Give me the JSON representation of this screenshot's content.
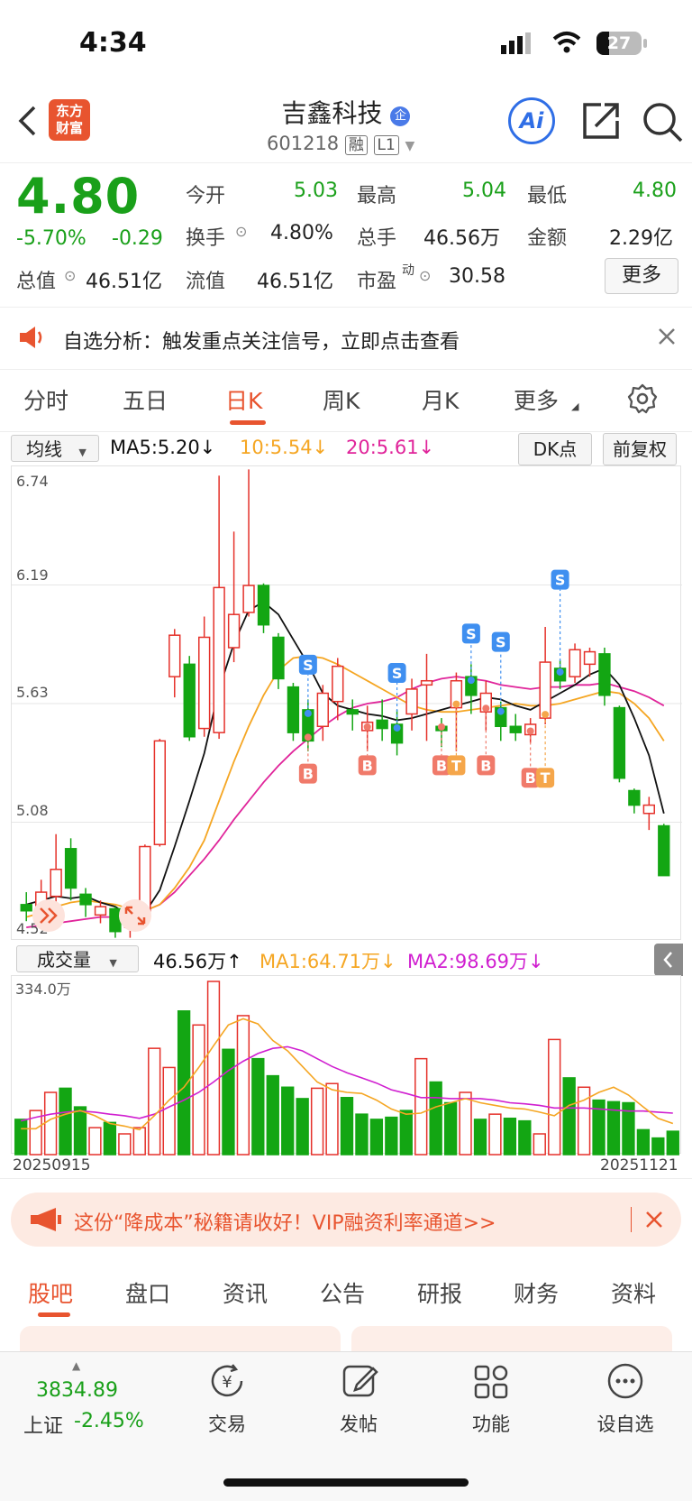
{
  "status_bar": {
    "time": "4:34",
    "battery": "27"
  },
  "header": {
    "brand_line1": "东方",
    "brand_line2": "财富",
    "title": "吉鑫科技",
    "badge": "企",
    "code": "601218",
    "tag1": "融",
    "tag2": "L1",
    "ai_label": "Ai"
  },
  "quote": {
    "price": "4.80",
    "change_pct": "-5.70%",
    "change": "-0.29",
    "open_label": "今开",
    "open": "5.03",
    "high_label": "最高",
    "high": "5.04",
    "low_label": "最低",
    "low": "4.80",
    "turnover_label": "换手",
    "turnover": "4.80%",
    "volume_label": "总手",
    "volume": "46.56万",
    "amount_label": "金额",
    "amount": "2.29亿",
    "mktcap_label": "总值",
    "mktcap": "46.51亿",
    "float_label": "流值",
    "float": "46.51亿",
    "pe_label": "市盈",
    "pe_sup": "动",
    "pe": "30.58",
    "more_button": "更多"
  },
  "notice": {
    "text": "自选分析：触发重点关注信号，立即点击查看"
  },
  "chart_tabs": [
    "分时",
    "五日",
    "日K",
    "周K",
    "月K",
    "更多"
  ],
  "active_tab": "日K",
  "ma_bar": {
    "selector": "均线",
    "ma5": "MA5:5.20↓",
    "ma10": "10:5.54↓",
    "ma20": "20:5.61↓",
    "dk": "DK点",
    "adjust": "前复权"
  },
  "price_axis": [
    "6.74",
    "6.19",
    "5.63",
    "5.08",
    "4.52"
  ],
  "volume_bar": {
    "selector": "成交量",
    "vol": "46.56万↑",
    "ma1": "MA1:64.71万↓",
    "ma2": "MA2:98.69万↓",
    "axis_max": "334.0万",
    "start_date": "20250915",
    "end_date": "20251121"
  },
  "colors": {
    "up": "#e5312a",
    "down": "#13a613",
    "ma5": "#111111",
    "ma10": "#f5a623",
    "ma20": "#e0249a",
    "accent": "#e8542f"
  },
  "promo": {
    "text": "这份“降成本”秘籍请收好！VIP融资利率通道>>"
  },
  "bottom_tabs": [
    "股吧",
    "盘口",
    "资讯",
    "公告",
    "研报",
    "财务",
    "资料"
  ],
  "active_bottom_tab": "股吧",
  "dock": {
    "index_value": "3834.89",
    "index_name": "上证",
    "index_change": "-2.45%",
    "items": [
      "交易",
      "发帖",
      "功能",
      "设自选"
    ]
  },
  "chart_data": {
    "type": "candlestick",
    "y_range": [
      4.52,
      6.74
    ],
    "x_range": [
      "20250915",
      "20251121"
    ],
    "candles": [
      {
        "o": 4.66,
        "c": 4.63,
        "h": 4.72,
        "l": 4.58
      },
      {
        "o": 4.63,
        "c": 4.72,
        "h": 4.78,
        "l": 4.58
      },
      {
        "o": 4.7,
        "c": 4.83,
        "h": 5.0,
        "l": 4.65
      },
      {
        "o": 4.93,
        "c": 4.74,
        "h": 4.98,
        "l": 4.68
      },
      {
        "o": 4.71,
        "c": 4.66,
        "h": 4.74,
        "l": 4.6
      },
      {
        "o": 4.61,
        "c": 4.65,
        "h": 4.68,
        "l": 4.57
      },
      {
        "o": 4.64,
        "c": 4.53,
        "h": 4.65,
        "l": 4.5
      },
      {
        "o": 4.55,
        "c": 4.6,
        "h": 4.62,
        "l": 4.5
      },
      {
        "o": 4.62,
        "c": 4.94,
        "h": 4.95,
        "l": 4.6
      },
      {
        "o": 4.95,
        "c": 5.45,
        "h": 5.46,
        "l": 4.94
      },
      {
        "o": 5.76,
        "c": 5.96,
        "h": 5.99,
        "l": 5.66
      },
      {
        "o": 5.82,
        "c": 5.47,
        "h": 5.86,
        "l": 5.45
      },
      {
        "o": 5.51,
        "c": 5.95,
        "h": 6.05,
        "l": 5.47
      },
      {
        "o": 5.49,
        "c": 6.19,
        "h": 6.73,
        "l": 5.46
      },
      {
        "o": 5.9,
        "c": 6.06,
        "h": 6.46,
        "l": 5.83
      },
      {
        "o": 6.07,
        "c": 6.2,
        "h": 6.76,
        "l": 6.05
      },
      {
        "o": 6.2,
        "c": 6.01,
        "h": 6.21,
        "l": 5.97
      },
      {
        "o": 5.95,
        "c": 5.75,
        "h": 5.97,
        "l": 5.7
      },
      {
        "o": 5.71,
        "c": 5.49,
        "h": 5.73,
        "l": 5.45
      },
      {
        "o": 5.6,
        "c": 5.45,
        "h": 5.65,
        "l": 5.4
      },
      {
        "o": 5.52,
        "c": 5.68,
        "h": 5.72,
        "l": 5.45
      },
      {
        "o": 5.64,
        "c": 5.81,
        "h": 5.85,
        "l": 5.55
      },
      {
        "o": 5.6,
        "c": 5.58,
        "h": 5.65,
        "l": 5.5
      },
      {
        "o": 5.5,
        "c": 5.54,
        "h": 5.62,
        "l": 5.4
      },
      {
        "o": 5.55,
        "c": 5.51,
        "h": 5.65,
        "l": 5.45
      },
      {
        "o": 5.53,
        "c": 5.44,
        "h": 5.6,
        "l": 5.38
      },
      {
        "o": 5.58,
        "c": 5.7,
        "h": 5.75,
        "l": 5.5
      },
      {
        "o": 5.72,
        "c": 5.74,
        "h": 5.87,
        "l": 5.45
      },
      {
        "o": 5.52,
        "c": 5.5,
        "h": 5.56,
        "l": 5.42
      },
      {
        "o": 5.61,
        "c": 5.74,
        "h": 5.78,
        "l": 5.4
      },
      {
        "o": 5.76,
        "c": 5.67,
        "h": 5.82,
        "l": 5.58
      },
      {
        "o": 5.59,
        "c": 5.68,
        "h": 5.74,
        "l": 5.5
      },
      {
        "o": 5.61,
        "c": 5.52,
        "h": 5.64,
        "l": 5.45
      },
      {
        "o": 5.52,
        "c": 5.49,
        "h": 5.58,
        "l": 5.45
      },
      {
        "o": 5.48,
        "c": 5.53,
        "h": 5.56,
        "l": 5.44
      },
      {
        "o": 5.56,
        "c": 5.83,
        "h": 6.0,
        "l": 5.53
      },
      {
        "o": 5.8,
        "c": 5.74,
        "h": 5.84,
        "l": 5.7
      },
      {
        "o": 5.76,
        "c": 5.89,
        "h": 5.92,
        "l": 5.73
      },
      {
        "o": 5.82,
        "c": 5.88,
        "h": 5.9,
        "l": 5.76
      },
      {
        "o": 5.87,
        "c": 5.67,
        "h": 5.9,
        "l": 5.62
      },
      {
        "o": 5.61,
        "c": 5.27,
        "h": 5.62,
        "l": 5.25
      },
      {
        "o": 5.21,
        "c": 5.14,
        "h": 5.22,
        "l": 5.1
      },
      {
        "o": 5.1,
        "c": 5.14,
        "h": 5.18,
        "l": 5.02
      },
      {
        "o": 5.04,
        "c": 4.8,
        "h": 5.05,
        "l": 4.8
      }
    ],
    "ma5": [
      4.66,
      4.68,
      4.7,
      4.69,
      4.7,
      4.67,
      4.65,
      4.6,
      4.62,
      4.73,
      4.94,
      5.16,
      5.39,
      5.7,
      5.92,
      6.08,
      6.12,
      6.06,
      5.94,
      5.82,
      5.68,
      5.62,
      5.6,
      5.58,
      5.57,
      5.55,
      5.56,
      5.58,
      5.6,
      5.62,
      5.64,
      5.66,
      5.65,
      5.62,
      5.6,
      5.64,
      5.68,
      5.72,
      5.77,
      5.8,
      5.72,
      5.56,
      5.38,
      5.1
    ],
    "ma10": [
      4.6,
      4.62,
      4.65,
      4.67,
      4.68,
      4.67,
      4.66,
      4.64,
      4.63,
      4.66,
      4.74,
      4.84,
      4.97,
      5.16,
      5.35,
      5.52,
      5.67,
      5.79,
      5.85,
      5.86,
      5.85,
      5.82,
      5.78,
      5.74,
      5.7,
      5.66,
      5.62,
      5.6,
      5.59,
      5.59,
      5.6,
      5.61,
      5.62,
      5.63,
      5.62,
      5.62,
      5.63,
      5.65,
      5.67,
      5.69,
      5.68,
      5.63,
      5.56,
      5.45
    ],
    "ma20": [
      4.55,
      4.56,
      4.57,
      4.58,
      4.59,
      4.6,
      4.6,
      4.61,
      4.63,
      4.66,
      4.72,
      4.8,
      4.88,
      4.97,
      5.07,
      5.16,
      5.25,
      5.33,
      5.4,
      5.46,
      5.52,
      5.57,
      5.61,
      5.63,
      5.64,
      5.66,
      5.7,
      5.73,
      5.75,
      5.76,
      5.75,
      5.74,
      5.72,
      5.71,
      5.7,
      5.71,
      5.71,
      5.72,
      5.72,
      5.73,
      5.71,
      5.69,
      5.66,
      5.62
    ],
    "signals": [
      {
        "i": 19,
        "type": "S",
        "p": 5.77
      },
      {
        "i": 19,
        "type": "B",
        "p": 5.34
      },
      {
        "i": 23,
        "type": "B",
        "p": 5.38
      },
      {
        "i": 25,
        "type": "S",
        "p": 5.73
      },
      {
        "i": 28,
        "type": "B",
        "p": 5.38
      },
      {
        "i": 29,
        "type": "T",
        "p": 5.38
      },
      {
        "i": 30,
        "type": "S",
        "p": 5.92
      },
      {
        "i": 31,
        "type": "B",
        "p": 5.38
      },
      {
        "i": 32,
        "type": "S",
        "p": 5.88
      },
      {
        "i": 34,
        "type": "B",
        "p": 5.32
      },
      {
        "i": 35,
        "type": "T",
        "p": 5.32
      },
      {
        "i": 36,
        "type": "S",
        "p": 6.18
      }
    ],
    "volume_range": [
      0,
      334.0
    ],
    "volumes": [
      {
        "v": 68,
        "up": false
      },
      {
        "v": 85,
        "up": true
      },
      {
        "v": 120,
        "up": true
      },
      {
        "v": 128,
        "up": false
      },
      {
        "v": 92,
        "up": false
      },
      {
        "v": 52,
        "up": true
      },
      {
        "v": 62,
        "up": false
      },
      {
        "v": 40,
        "up": true
      },
      {
        "v": 52,
        "up": true
      },
      {
        "v": 205,
        "up": true
      },
      {
        "v": 168,
        "up": true
      },
      {
        "v": 277,
        "up": false
      },
      {
        "v": 250,
        "up": true
      },
      {
        "v": 334,
        "up": true
      },
      {
        "v": 203,
        "up": false
      },
      {
        "v": 268,
        "up": true
      },
      {
        "v": 185,
        "up": false
      },
      {
        "v": 152,
        "up": false
      },
      {
        "v": 130,
        "up": false
      },
      {
        "v": 108,
        "up": false
      },
      {
        "v": 128,
        "up": true
      },
      {
        "v": 137,
        "up": true
      },
      {
        "v": 110,
        "up": false
      },
      {
        "v": 78,
        "up": false
      },
      {
        "v": 68,
        "up": false
      },
      {
        "v": 72,
        "up": false
      },
      {
        "v": 85,
        "up": false
      },
      {
        "v": 185,
        "up": true
      },
      {
        "v": 140,
        "up": false
      },
      {
        "v": 100,
        "up": false
      },
      {
        "v": 120,
        "up": true
      },
      {
        "v": 68,
        "up": false
      },
      {
        "v": 78,
        "up": true
      },
      {
        "v": 70,
        "up": false
      },
      {
        "v": 65,
        "up": false
      },
      {
        "v": 40,
        "up": true
      },
      {
        "v": 222,
        "up": true
      },
      {
        "v": 148,
        "up": false
      },
      {
        "v": 130,
        "up": true
      },
      {
        "v": 105,
        "up": false
      },
      {
        "v": 102,
        "up": false
      },
      {
        "v": 100,
        "up": false
      },
      {
        "v": 48,
        "up": false
      },
      {
        "v": 32,
        "up": false
      },
      {
        "v": 45,
        "up": false
      }
    ],
    "vol_ma1": [
      50,
      50,
      68,
      78,
      85,
      75,
      60,
      55,
      48,
      75,
      105,
      130,
      168,
      210,
      250,
      262,
      252,
      220,
      200,
      170,
      140,
      125,
      120,
      118,
      105,
      88,
      78,
      80,
      92,
      100,
      108,
      100,
      95,
      90,
      88,
      82,
      75,
      95,
      105,
      120,
      130,
      115,
      92,
      70,
      60
    ],
    "vol_ma2": [
      65,
      72,
      78,
      82,
      84,
      82,
      78,
      75,
      70,
      78,
      92,
      105,
      120,
      140,
      162,
      180,
      195,
      205,
      208,
      200,
      185,
      170,
      158,
      148,
      138,
      125,
      118,
      110,
      110,
      108,
      108,
      108,
      105,
      100,
      98,
      95,
      90,
      90,
      90,
      88,
      86,
      84,
      84,
      82,
      80
    ]
  }
}
